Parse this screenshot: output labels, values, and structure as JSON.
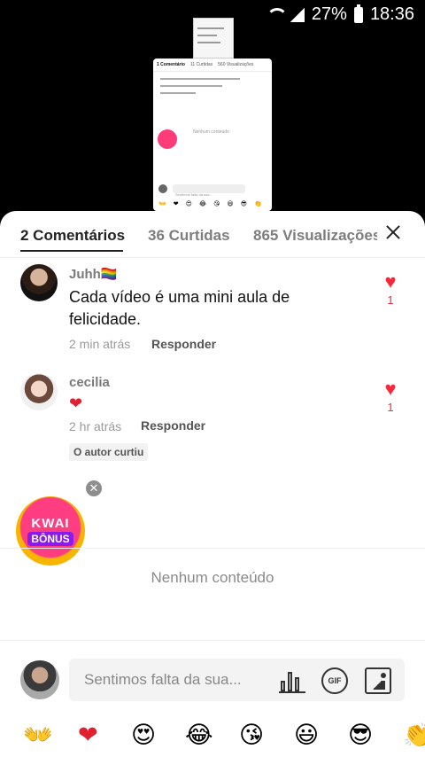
{
  "status_bar": {
    "battery": "27%",
    "time": "18:36"
  },
  "preview": {
    "tabs": [
      "1 Comentário",
      "11 Curtidas",
      "560 Visualizações"
    ],
    "empty_text": "Nenhum conteúdo",
    "input_placeholder": "Sentimos falta da sua...",
    "emojis": [
      "👐",
      "❤",
      "😍",
      "😂",
      "😘",
      "😃",
      "😎",
      "👏"
    ]
  },
  "tabs": {
    "comments": "2 Comentários",
    "likes": "36 Curtidas",
    "views": "865 Visualizações"
  },
  "comments": [
    {
      "username": "Juhh🏳️‍🌈",
      "text": "Cada vídeo é uma mini aula de felicidade.",
      "time": "2 min atrás",
      "reply": "Responder",
      "like_icon": "heart-icon",
      "likes": "1"
    },
    {
      "username": "cecilia",
      "text": "❤",
      "time": "2 hr atrás",
      "reply": "Responder",
      "like_icon": "heart-icon",
      "likes": "1",
      "badge": "O autor curtiu"
    }
  ],
  "kwai_bonus": {
    "line1": "KWAI",
    "line2": "BÔNUS"
  },
  "empty_text": "Nenhum conteúdo",
  "composer": {
    "placeholder": "Sentimos falta da sua...",
    "gif_label": "GIF"
  },
  "emoji_bar": [
    "👐",
    "❤",
    "😍",
    "😂",
    "😘",
    "😃",
    "😎",
    "👏"
  ],
  "colors": {
    "accent_red": "#f5293c",
    "sheet_bg": "#ffffff",
    "backdrop": "#000000"
  }
}
